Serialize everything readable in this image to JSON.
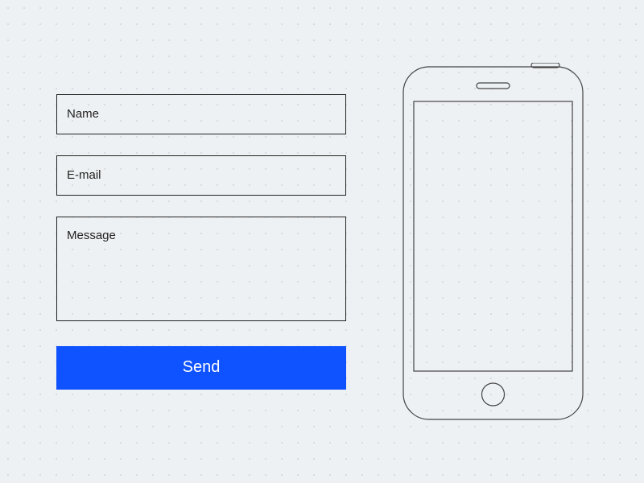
{
  "form": {
    "name_placeholder": "Name",
    "email_placeholder": "E-mail",
    "message_placeholder": "Message",
    "send_label": "Send"
  }
}
